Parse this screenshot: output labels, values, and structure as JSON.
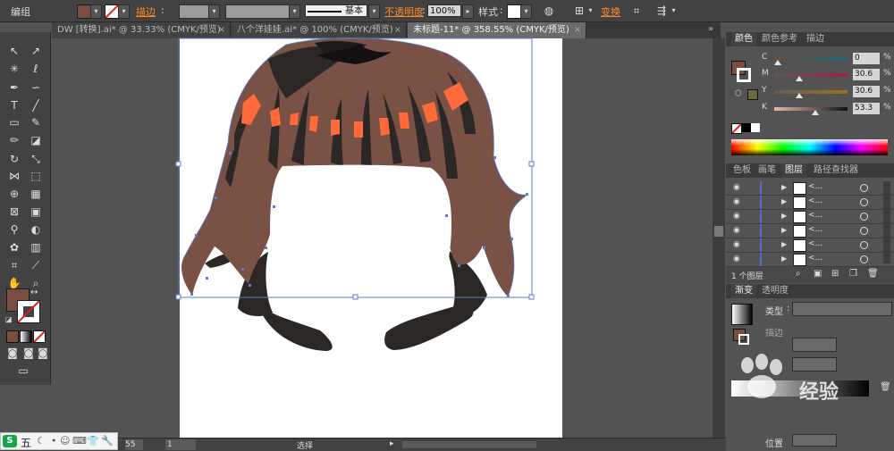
{
  "control_bar": {
    "group_label": "编组",
    "stroke_label": "描边",
    "stroke_profile": "基本",
    "opacity_label": "不透明度",
    "opacity_value": "100%",
    "style_label": "样式",
    "transform_label": "变换",
    "fill_color": "#7a4e3e"
  },
  "doc_tabs": [
    {
      "label": "DW [转换].ai* @ 33.33% (CMYK/预览)"
    },
    {
      "label": "八个洋娃娃.ai* @ 100% (CMYK/预览)"
    },
    {
      "label": "未标题-11* @ 358.55% (CMYK/预览)"
    }
  ],
  "color_panel": {
    "tabs": [
      "颜色",
      "颜色参考",
      "描边"
    ],
    "sliders": [
      {
        "letter": "C",
        "value": "0",
        "pct": "%"
      },
      {
        "letter": "M",
        "value": "30.6",
        "pct": "%"
      },
      {
        "letter": "Y",
        "value": "30.6",
        "pct": "%"
      },
      {
        "letter": "K",
        "value": "53.3",
        "pct": "%"
      }
    ]
  },
  "layers_panel": {
    "tabs": [
      "色板",
      "画笔",
      "图层",
      "路径查找器"
    ],
    "row_label": "<...",
    "row_count": 6,
    "footer": "1 个图层"
  },
  "gradient_panel": {
    "tabs": [
      "渐变",
      "透明度"
    ],
    "type_label": "类型",
    "stroke_label": "描边",
    "position_label": "位置"
  },
  "status": {
    "zoom": "55",
    "page": "1",
    "tool": "选择"
  },
  "ime": {
    "label": "五"
  },
  "watermark": {
    "text": "经验"
  }
}
